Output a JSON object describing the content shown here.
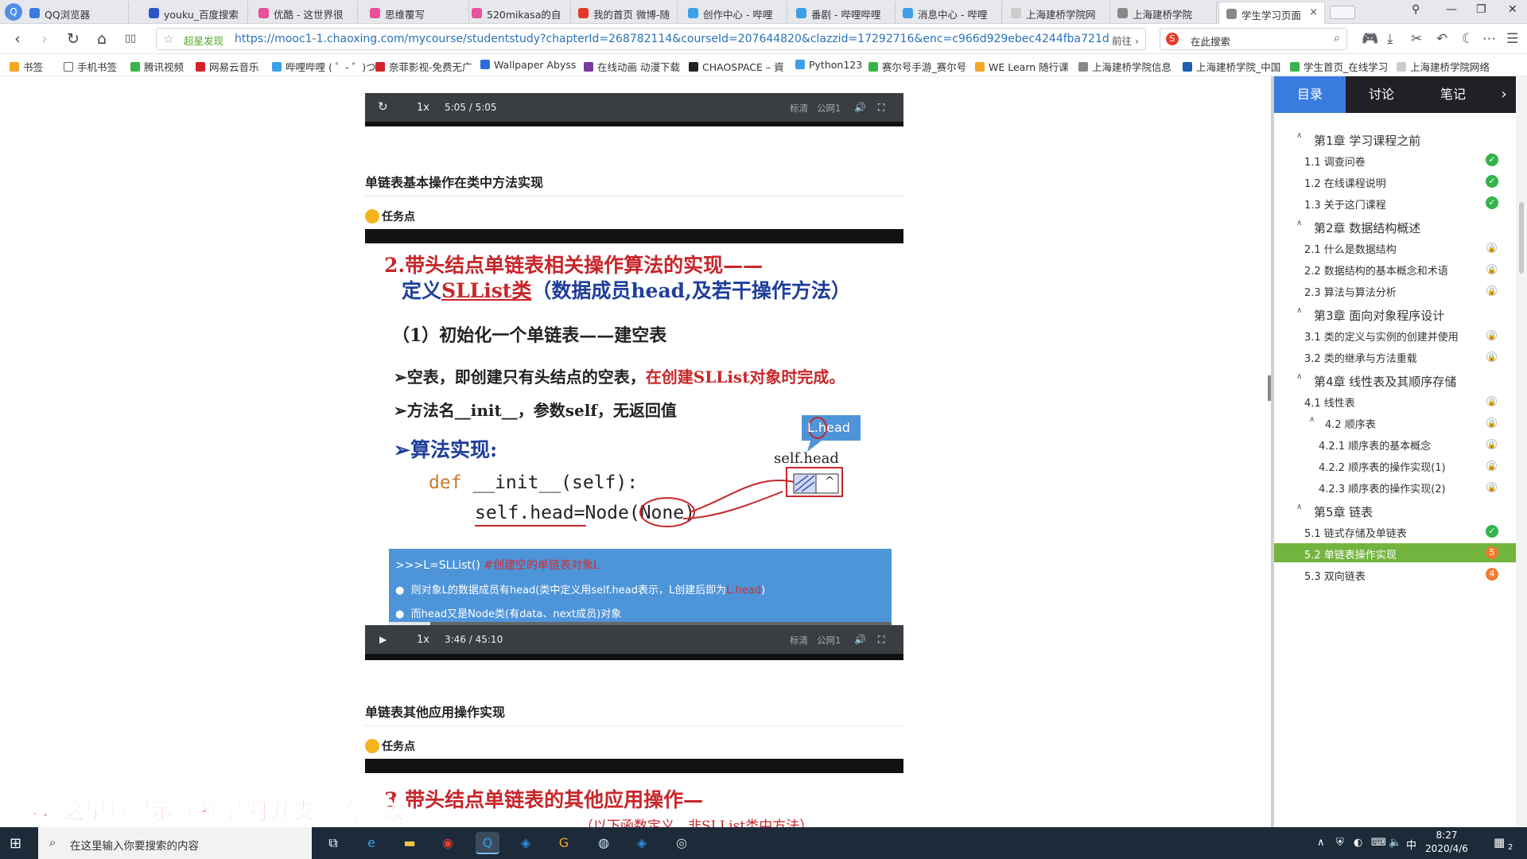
{
  "browser": {
    "logo": "Q",
    "tabs": [
      {
        "label": "QQ浏览器",
        "color": "#3a7be0"
      },
      {
        "label": "youku_百度搜索",
        "color": "#2b55c8"
      },
      {
        "label": "优酷 - 这世界很",
        "color": "#e94f9b"
      },
      {
        "label": "思维覆写",
        "color": "#e94f9b"
      },
      {
        "label": "520mikasa的自",
        "color": "#e94f9b"
      },
      {
        "label": "我的首页 微博-随",
        "color": "#e6392c"
      },
      {
        "label": "创作中心 - 哔哩",
        "color": "#3ca0e6"
      },
      {
        "label": "番剧 - 哔哩哔哩",
        "color": "#3ca0e6"
      },
      {
        "label": "消息中心 - 哔哩",
        "color": "#3ca0e6"
      },
      {
        "label": "上海建桥学院网",
        "color": "#cccccc"
      },
      {
        "label": "上海建桥学院",
        "color": "#888888"
      },
      {
        "label": "学生学习页面",
        "color": "#888888",
        "active": true
      }
    ],
    "close_tab": "×",
    "window_controls": [
      "⚲",
      "—",
      "❐",
      "✕"
    ],
    "nav": {
      "back": "‹",
      "forward": "›",
      "refresh": "↻",
      "home": "⌂",
      "reader": "▯▯"
    },
    "address": {
      "star": "☆",
      "badge": "超星发现",
      "url": "https://mooc1-1.chaoxing.com/mycourse/studentstudy?chapterId=268782114&courseId=207644820&clazzid=17292716&enc=c966d929ebec4244fba721d",
      "go_label": "前往 ›"
    },
    "search": {
      "engine_icon": "S",
      "placeholder": "在此搜索",
      "mag": "⌕"
    },
    "toolbar_icons": [
      "🎮",
      "⤓",
      "✂",
      "↶",
      "☾",
      "⋯",
      "☰"
    ]
  },
  "bookmarks": [
    {
      "label": "书签",
      "color": "#f5a623"
    },
    {
      "label": "手机书签",
      "color": "#ffffff"
    },
    {
      "label": "腾讯视频",
      "color": "#3ab34a"
    },
    {
      "label": "网易云音乐",
      "color": "#d3222a"
    },
    {
      "label": "哔哩哔哩 ( ゜- ゜)つ",
      "color": "#3ca0e6"
    },
    {
      "label": "奈菲影视-免费无广",
      "color": "#d3222a"
    },
    {
      "label": "Wallpaper Abyss",
      "color": "#2e6be0"
    },
    {
      "label": "在线动画 动漫下载",
      "color": "#7a3aa0"
    },
    {
      "label": "CHAOSPACE – 資",
      "color": "#222222"
    },
    {
      "label": "Python123",
      "color": "#3ca0e6"
    },
    {
      "label": "赛尔号手游_赛尔号",
      "color": "#3ab34a"
    },
    {
      "label": "WE Learn 随行课",
      "color": "#f5a623"
    },
    {
      "label": "上海建桥学院信息",
      "color": "#888888"
    },
    {
      "label": "上海建桥学院_中国",
      "color": "#1f5fb8"
    },
    {
      "label": "学生首页_在线学习",
      "color": "#3ab34a"
    },
    {
      "label": "上海建桥学院网络",
      "color": "#cccccc"
    }
  ],
  "video1": {
    "play": "↻",
    "speed": "1x",
    "time": "5:05  /  5:05",
    "quality": "标清",
    "line": "公网1",
    "volume": "🔊",
    "fullscreen": "⛶"
  },
  "section1": {
    "title": "单链表基本操作在类中方法实现",
    "task": "任务点",
    "slide": {
      "heading_a": "2.带头结点单链表相关操作算法的实现——",
      "heading_b_prefix": "定义",
      "heading_b_class": "SLList类",
      "heading_b_rest": "（数据成员head,及若干操作方法）",
      "sub": "（1）初始化一个单链表——建空表",
      "bullet1_prefix": "➢空表，即创建只有头结点的空表，",
      "bullet1_red": "在创建SLList对象时完成。",
      "bullet2": "➢方法名__init__，参数self，无返回值",
      "algo": "➢算法实现:",
      "code1_kw": "def",
      "code1_rest": "  __init__(self):",
      "code2": "self.head=Node(None)",
      "lhead": "L.head",
      "selfhead": "self.head",
      "node_caret": "^",
      "box_line1_a": ">>>L=SLList()",
      "box_line1_b": "  #创建空的单链表对象L",
      "box_line2_a": "则对象L的数据成员有head(类中定义用self.head表示，L创建后即为",
      "box_line2_b": "L.head",
      "box_line2_c": ")",
      "box_line3": "而head又是Node类(有data、next成员)对象"
    },
    "video": {
      "play": "▶",
      "speed": "1x",
      "time": "3:46  /  45:10",
      "quality": "标清",
      "line": "公网1",
      "volume": "🔊",
      "fullscreen": "⛶",
      "progress": 0.083
    }
  },
  "section2": {
    "title": "单链表其他应用操作实现",
    "task": "任务点",
    "slide_heading": "3.带头结点单链表的其他应用操作—",
    "slide_sub": "（以下函数定义，非SLList类中方法）"
  },
  "lyrics_watermark": "器，这里将显示歌名   请打开支持的播放",
  "panel": {
    "tabs": [
      {
        "label": "目录",
        "active": true
      },
      {
        "label": "讨论"
      },
      {
        "label": "笔记"
      }
    ],
    "arrow": "›",
    "toc": [
      {
        "label": "第1章 学习课程之前",
        "level": 0,
        "caret": "∧"
      },
      {
        "label": "1.1 调查问卷",
        "level": 1,
        "status": "done"
      },
      {
        "label": "1.2 在线课程说明",
        "level": 1,
        "status": "done"
      },
      {
        "label": "1.3 关于这门课程",
        "level": 1,
        "status": "done"
      },
      {
        "label": "第2章 数据结构概述",
        "level": 0,
        "caret": "∧"
      },
      {
        "label": "2.1 什么是数据结构",
        "level": 1,
        "status": "lock"
      },
      {
        "label": "2.2 数据结构的基本概念和术语",
        "level": 1,
        "status": "lock"
      },
      {
        "label": "2.3 算法与算法分析",
        "level": 1,
        "status": "lock"
      },
      {
        "label": "第3章 面向对象程序设计",
        "level": 0,
        "caret": "∧"
      },
      {
        "label": "3.1 类的定义与实例的创建并使用",
        "level": 1,
        "status": "lock"
      },
      {
        "label": "3.2 类的继承与方法重载",
        "level": 1,
        "status": "lock"
      },
      {
        "label": "第4章 线性表及其顺序存储",
        "level": 0,
        "caret": "∧"
      },
      {
        "label": "4.1 线性表",
        "level": 1,
        "status": "lock"
      },
      {
        "label": "4.2 顺序表",
        "level": 2,
        "caret": "∧",
        "status": "lock"
      },
      {
        "label": "4.2.1 顺序表的基本概念",
        "level": 3,
        "status": "lock"
      },
      {
        "label": "4.2.2 顺序表的操作实现(1)",
        "level": 3,
        "status": "lock"
      },
      {
        "label": "4.2.3 顺序表的操作实现(2)",
        "level": 3,
        "status": "lock"
      },
      {
        "label": "第5章 链表",
        "level": 0,
        "caret": "∧"
      },
      {
        "label": "5.1 链式存储及单链表",
        "level": 1,
        "status": "done"
      },
      {
        "label": "5.2 单链表操作实现",
        "level": 1,
        "status": "count",
        "count": "5",
        "current": true
      },
      {
        "label": "5.3 双向链表",
        "level": 1,
        "status": "count",
        "count": "4"
      }
    ],
    "done_mark": "✓",
    "lock_mark": "🔒"
  },
  "taskbar": {
    "start": "⊞",
    "search_placeholder": "在这里输入你要搜索的内容",
    "search_icon": "⌕",
    "apps": [
      {
        "name": "task-view",
        "glyph": "⧉",
        "color": "#ffffff"
      },
      {
        "name": "edge",
        "glyph": "e",
        "color": "#3ca0e6"
      },
      {
        "name": "file-explorer",
        "glyph": "▬",
        "color": "#f5c542"
      },
      {
        "name": "qq",
        "glyph": "◉",
        "color": "#e6392c"
      },
      {
        "name": "qq-browser",
        "glyph": "Q",
        "color": "#3a9be0",
        "active": true
      },
      {
        "name": "pycharm",
        "glyph": "◈",
        "color": "#2e8be0"
      },
      {
        "name": "app-g",
        "glyph": "G",
        "color": "#f5a623"
      },
      {
        "name": "globe",
        "glyph": "◍",
        "color": "#cde4f7"
      },
      {
        "name": "vs",
        "glyph": "◈",
        "color": "#2e8be0"
      },
      {
        "name": "obs",
        "glyph": "◎",
        "color": "#dddddd"
      }
    ],
    "tray": {
      "chevron": "∧",
      "shield": "⛨",
      "weibo": "◐",
      "network": "⌨",
      "speaker": "🔈",
      "ime": "中",
      "grid": "▦"
    },
    "time": "8:27",
    "date": "2020/4/6",
    "notifications": "2"
  }
}
